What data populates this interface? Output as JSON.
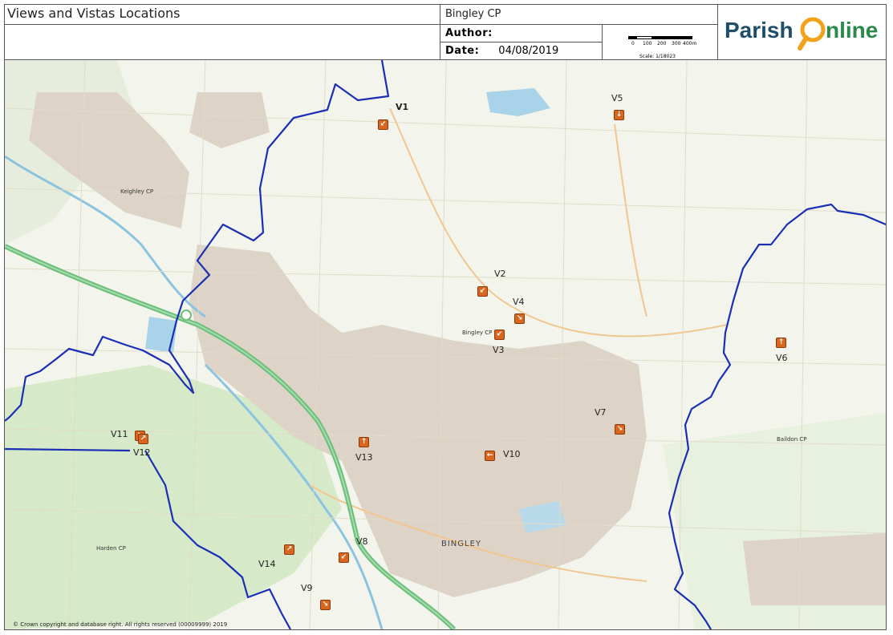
{
  "header": {
    "title": "Views and Vistas Locations",
    "parish": "Bingley CP",
    "author_label": "Author:",
    "date_label": "Date:",
    "date_value": "04/08/2019",
    "scale_ticks": [
      "0",
      "100",
      "200",
      "300",
      "400m"
    ],
    "scale_ratio": "Scale: 1/18023",
    "logo_text_1": "Parish",
    "logo_text_2": "nline"
  },
  "map": {
    "copyright": "© Crown copyright and database right. All rights reserved (00009999) 2019",
    "town_label": "BINGLEY",
    "parish_labels": [
      "Keighley CP",
      "Bingley CP",
      "Baildon CP",
      "Harden CP"
    ],
    "views": [
      {
        "label": "V1",
        "arrow": "↙"
      },
      {
        "label": "V2",
        "arrow": "↙"
      },
      {
        "label": "V3",
        "arrow": "↙"
      },
      {
        "label": "V4",
        "arrow": "↘"
      },
      {
        "label": "V5",
        "arrow": "↓"
      },
      {
        "label": "V6",
        "arrow": "↑"
      },
      {
        "label": "V7",
        "arrow": "↘"
      },
      {
        "label": "V8",
        "arrow": "↙"
      },
      {
        "label": "V9",
        "arrow": "↘"
      },
      {
        "label": "V10",
        "arrow": "←"
      },
      {
        "label": "V11",
        "arrow": "↘"
      },
      {
        "label": "V12",
        "arrow": "↗"
      },
      {
        "label": "V13",
        "arrow": "↑"
      },
      {
        "label": "V14",
        "arrow": "↗"
      }
    ],
    "colors": {
      "boundary": "#1a2fb5",
      "marker": "#d9661f",
      "road": "#6cbf7a",
      "urban": "#d8cfc4",
      "green": "#cfe5c0",
      "water": "#a9d3e8"
    }
  }
}
